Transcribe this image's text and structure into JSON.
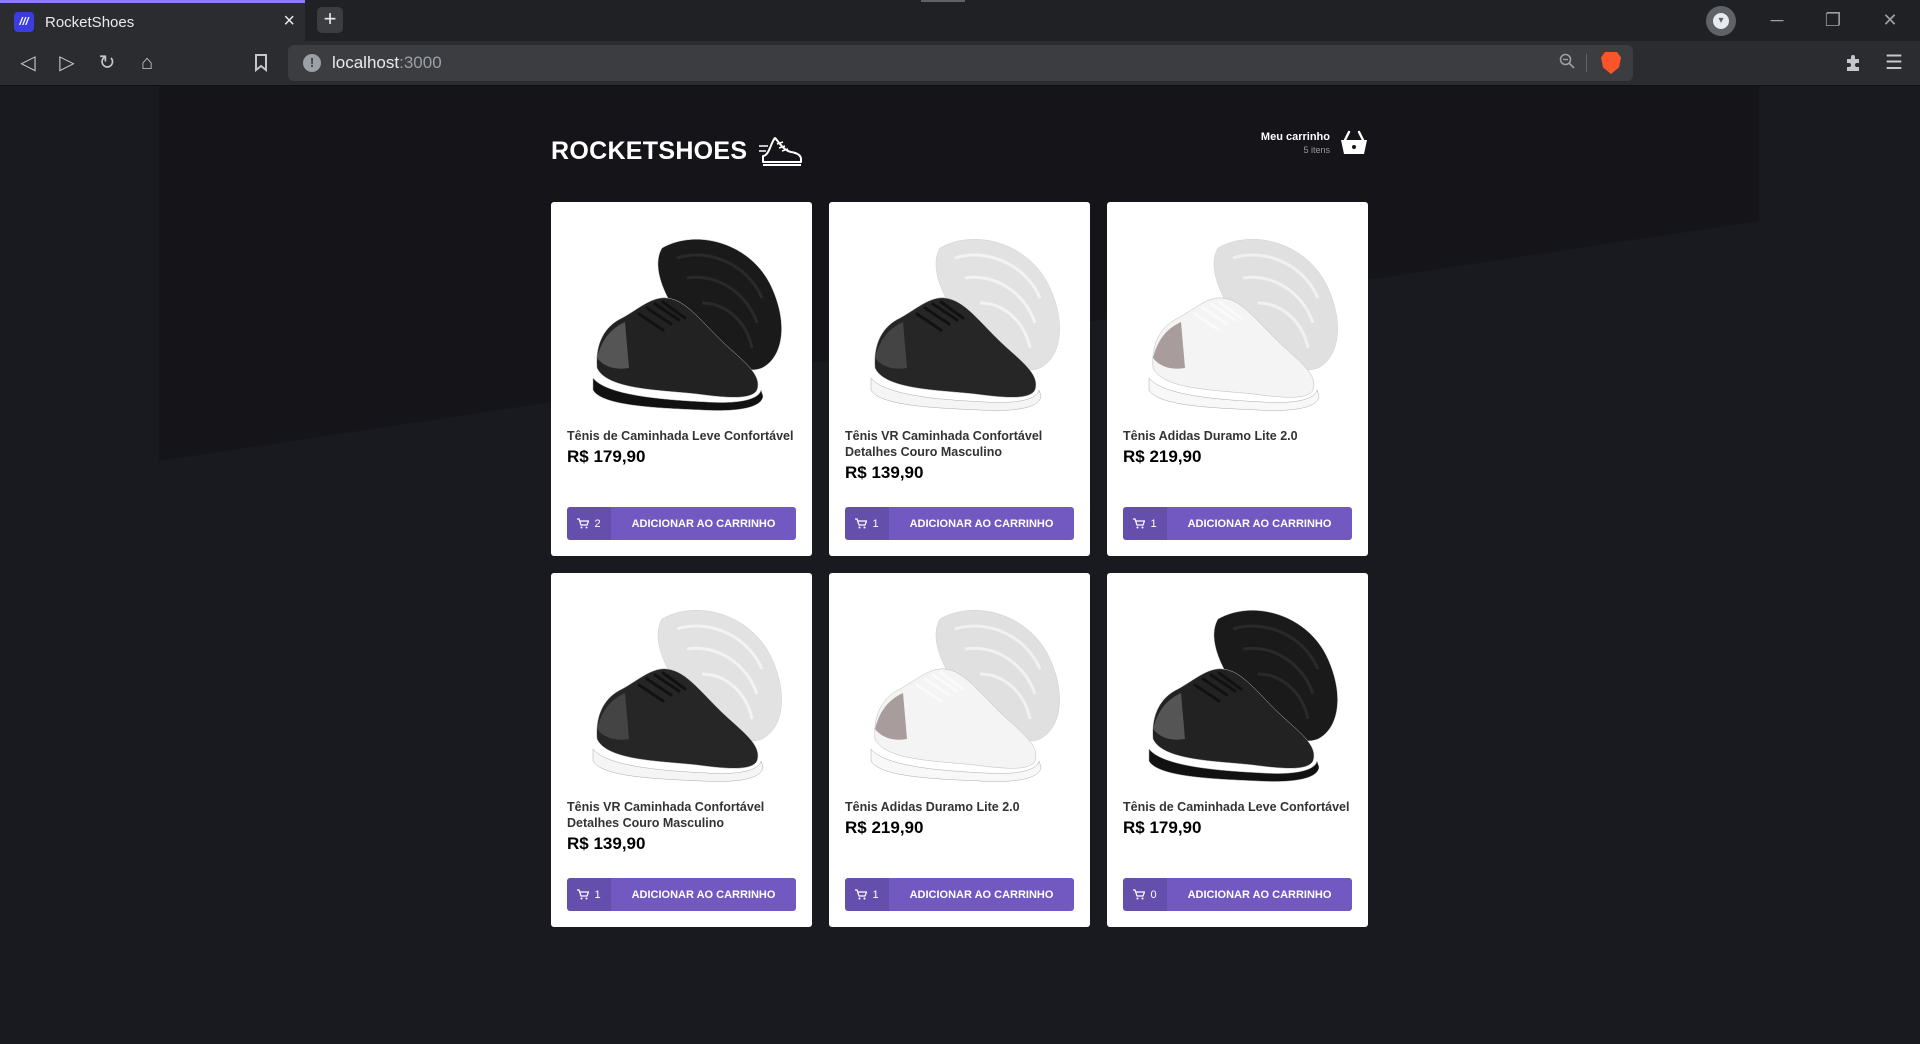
{
  "browser": {
    "tab_title": "RocketShoes",
    "favicon_text": "///",
    "url_host": "localhost",
    "url_port": ":3000",
    "new_tab_symbol": "+",
    "close_symbol": "×"
  },
  "header": {
    "logo_text": "ROCKETSHOES",
    "cart_title": "Meu carrinho",
    "cart_count": "5 itens"
  },
  "colors": {
    "background": "#191920",
    "accent": "#7159c1",
    "card": "#ffffff"
  },
  "products": [
    {
      "name": "Tênis de Caminhada Leve Confortável",
      "price": "R$ 179,90",
      "qty": "2",
      "button": "ADICIONAR AO CARRINHO",
      "variant": "black"
    },
    {
      "name": "Tênis VR Caminhada Confortável Detalhes Couro Masculino",
      "price": "R$ 139,90",
      "qty": "1",
      "button": "ADICIONAR AO CARRINHO",
      "variant": "black-white"
    },
    {
      "name": "Tênis Adidas Duramo Lite 2.0",
      "price": "R$ 219,90",
      "qty": "1",
      "button": "ADICIONAR AO CARRINHO",
      "variant": "white"
    },
    {
      "name": "Tênis VR Caminhada Confortável Detalhes Couro Masculino",
      "price": "R$ 139,90",
      "qty": "1",
      "button": "ADICIONAR AO CARRINHO",
      "variant": "black-white"
    },
    {
      "name": "Tênis Adidas Duramo Lite 2.0",
      "price": "R$ 219,90",
      "qty": "1",
      "button": "ADICIONAR AO CARRINHO",
      "variant": "white"
    },
    {
      "name": "Tênis de Caminhada Leve Confortável",
      "price": "R$ 179,90",
      "qty": "0",
      "button": "ADICIONAR AO CARRINHO",
      "variant": "black"
    }
  ]
}
